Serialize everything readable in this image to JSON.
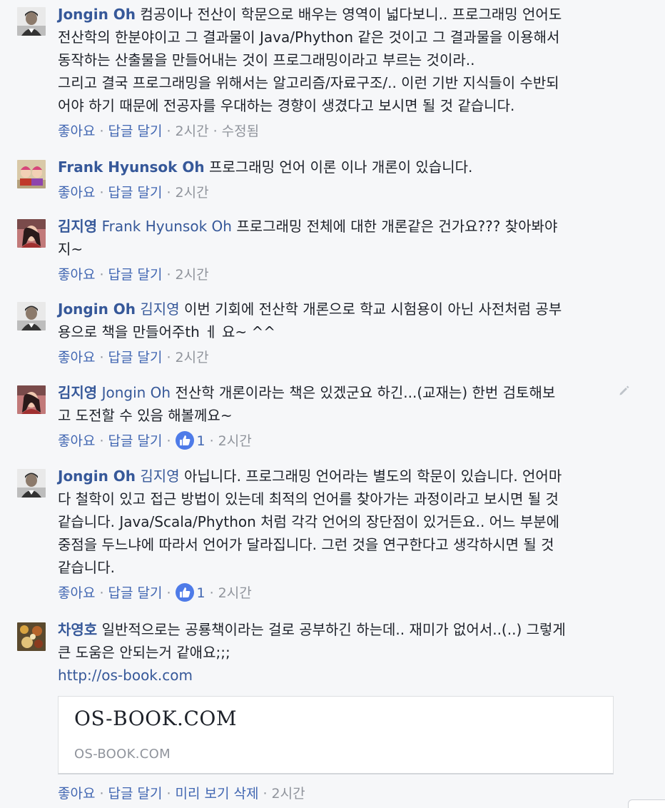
{
  "comments": [
    {
      "author": "Jongin Oh",
      "lines": [
        "컴공이나 전산이 학문으로 배우는 영역이 넓다보니.. 프로그래밍 언어도",
        "전산학의 한분야이고 그 결과물이 Java/Phython 같은 것이고 그 결과물을 이용해서",
        "동작하는 산출물을 만들어내는 것이 프로그래밍이라고 부르는 것이라..",
        "그리고 결국 프로그래밍을 위해서는 알고리즘/자료구조/.. 이런 기반 지식들이 수반되",
        "어야 하기 때문에 전공자를 우대하는 경향이 생겼다고 보시면 될 것 같습니다."
      ],
      "like": "좋아요",
      "reply": "답글 달기",
      "time": "2시간",
      "edited": "수정됨"
    },
    {
      "author": "Frank Hyunsok Oh",
      "lines": [
        "프로그래밍 언어 이론 이나 개론이 있습니다."
      ],
      "like": "좋아요",
      "reply": "답글 달기",
      "time": "2시간"
    },
    {
      "author": "김지영",
      "mention": "Frank Hyunsok Oh",
      "lines": [
        "프로그래밍 전체에 대한 개론같은 건가요??? 찾아봐야",
        "지~"
      ],
      "like": "좋아요",
      "reply": "답글 달기",
      "time": "2시간"
    },
    {
      "author": "Jongin Oh",
      "mention": "김지영",
      "lines": [
        "이번 기회에 전산학 개론으로 학교 시험용이 아닌 사전처럼 공부",
        "용으로 책을 만들어주th ㅔ 요~ ^^"
      ],
      "like": "좋아요",
      "reply": "답글 달기",
      "time": "2시간"
    },
    {
      "author": "김지영",
      "mention": "Jongin Oh",
      "lines": [
        "전산학 개론이라는 책은 있겠군요 하긴...(교재는) 한번 검토해보",
        "고 도전할 수 있음 해볼께요~"
      ],
      "like": "좋아요",
      "reply": "답글 달기",
      "reactions": "1",
      "time": "2시간"
    },
    {
      "author": "Jongin Oh",
      "mention": "김지영",
      "lines": [
        "아닙니다. 프로그래밍 언어라는 별도의 학문이 있습니다. 언어마",
        "다 철학이 있고 접근 방법이 있는데 최적의 언어를 찾아가는 과정이라고 보시면 될 것",
        "같습니다. Java/Scala/Phython 처럼 각각 언어의 장단점이 있거든요.. 어느 부분에",
        "중점을 두느냐에 따라서 언어가 달라집니다. 그런 것을 연구한다고 생각하시면 될 것",
        "같습니다."
      ],
      "like": "좋아요",
      "reply": "답글 달기",
      "reactions": "1",
      "time": "2시간"
    },
    {
      "author": "차영호",
      "lines": [
        "일반적으로는 공룡책이라는 걸로 공부하긴 하는데.. 재미가 없어서..(..) 그렇게",
        "큰 도움은 안되는거 같애요;;;"
      ],
      "link": "http://os-book.com",
      "preview": {
        "title": "OS-BOOK.COM",
        "domain": "OS-BOOK.COM"
      },
      "like": "좋아요",
      "reply": "답글 달기",
      "remove_preview": "미리 보기 삭제",
      "time": "2시간"
    }
  ],
  "colors": {
    "author": "#365899",
    "action": "#4267b2",
    "meta": "#90949c",
    "background": "#f6f7f9"
  }
}
